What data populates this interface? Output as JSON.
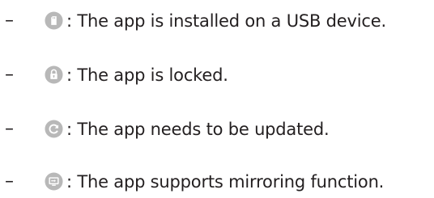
{
  "items": [
    {
      "dash": "–",
      "icon": "usb-icon",
      "text": ": The app is installed on a USB device."
    },
    {
      "dash": "–",
      "icon": "lock-icon",
      "text": ": The app is locked."
    },
    {
      "dash": "–",
      "icon": "update-icon",
      "text": ": The app needs to be updated."
    },
    {
      "dash": "–",
      "icon": "mirroring-icon",
      "text": ": The app supports mirroring function."
    }
  ],
  "colors": {
    "icon_bg": "#b8b8b8",
    "icon_fg": "#ffffff",
    "text": "#231f20"
  }
}
